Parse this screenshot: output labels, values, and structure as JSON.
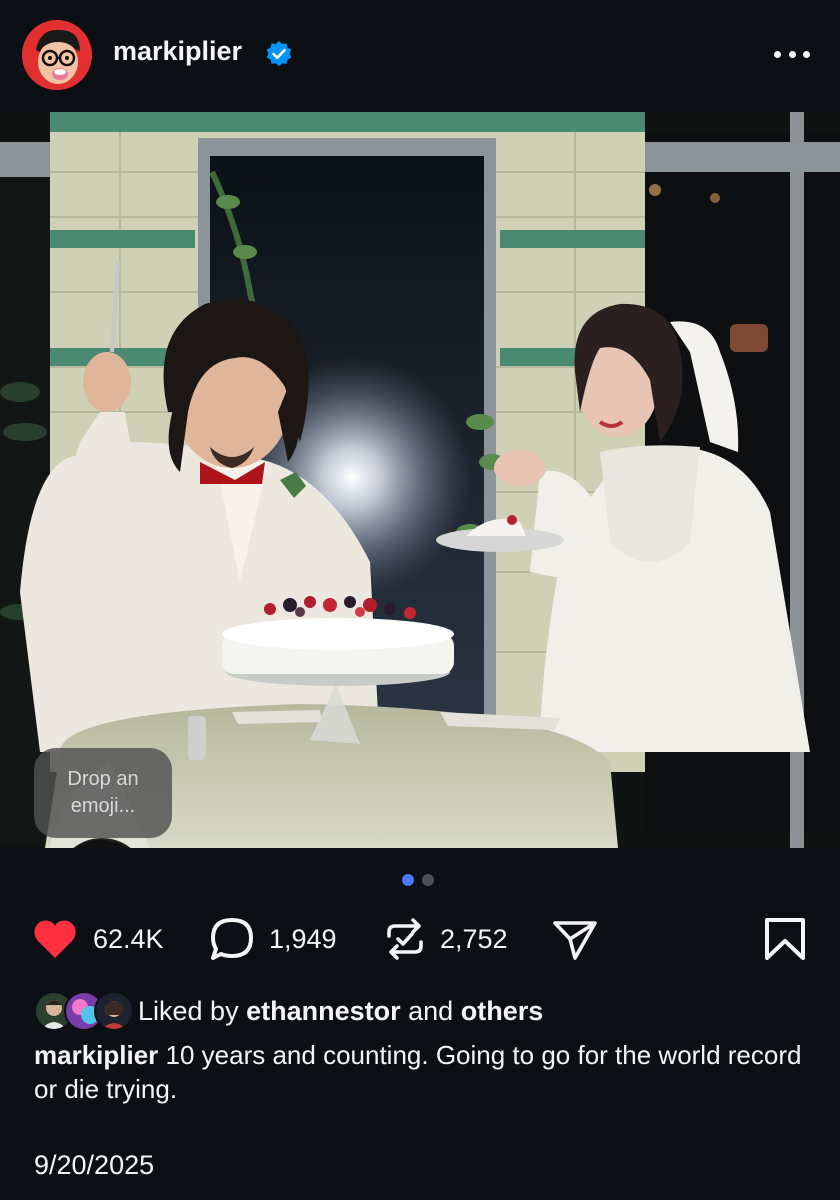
{
  "post": {
    "username": "markiplier",
    "verified_icon": "verified-badge-icon",
    "more_icon": "more-horizontal-icon",
    "emoji_prompt": "Drop an emoji...",
    "carousel": {
      "count": 2,
      "active_index": 0
    },
    "stats": {
      "likes": "62.4K",
      "comments": "1,949",
      "reposts": "2,752"
    },
    "liked_by": {
      "prefix": "Liked by",
      "user": "ethannestor",
      "conjunction": "and",
      "others": "others"
    },
    "caption": {
      "username": "markiplier",
      "text": "10 years and counting. Going to go for the world record or die trying."
    },
    "date": "9/20/2025"
  },
  "colors": {
    "background": "#0c1014",
    "like": "#ff3040",
    "verified": "#0095f6",
    "active_dot": "#4a7bff",
    "repost_badge": "#8e44ff"
  }
}
